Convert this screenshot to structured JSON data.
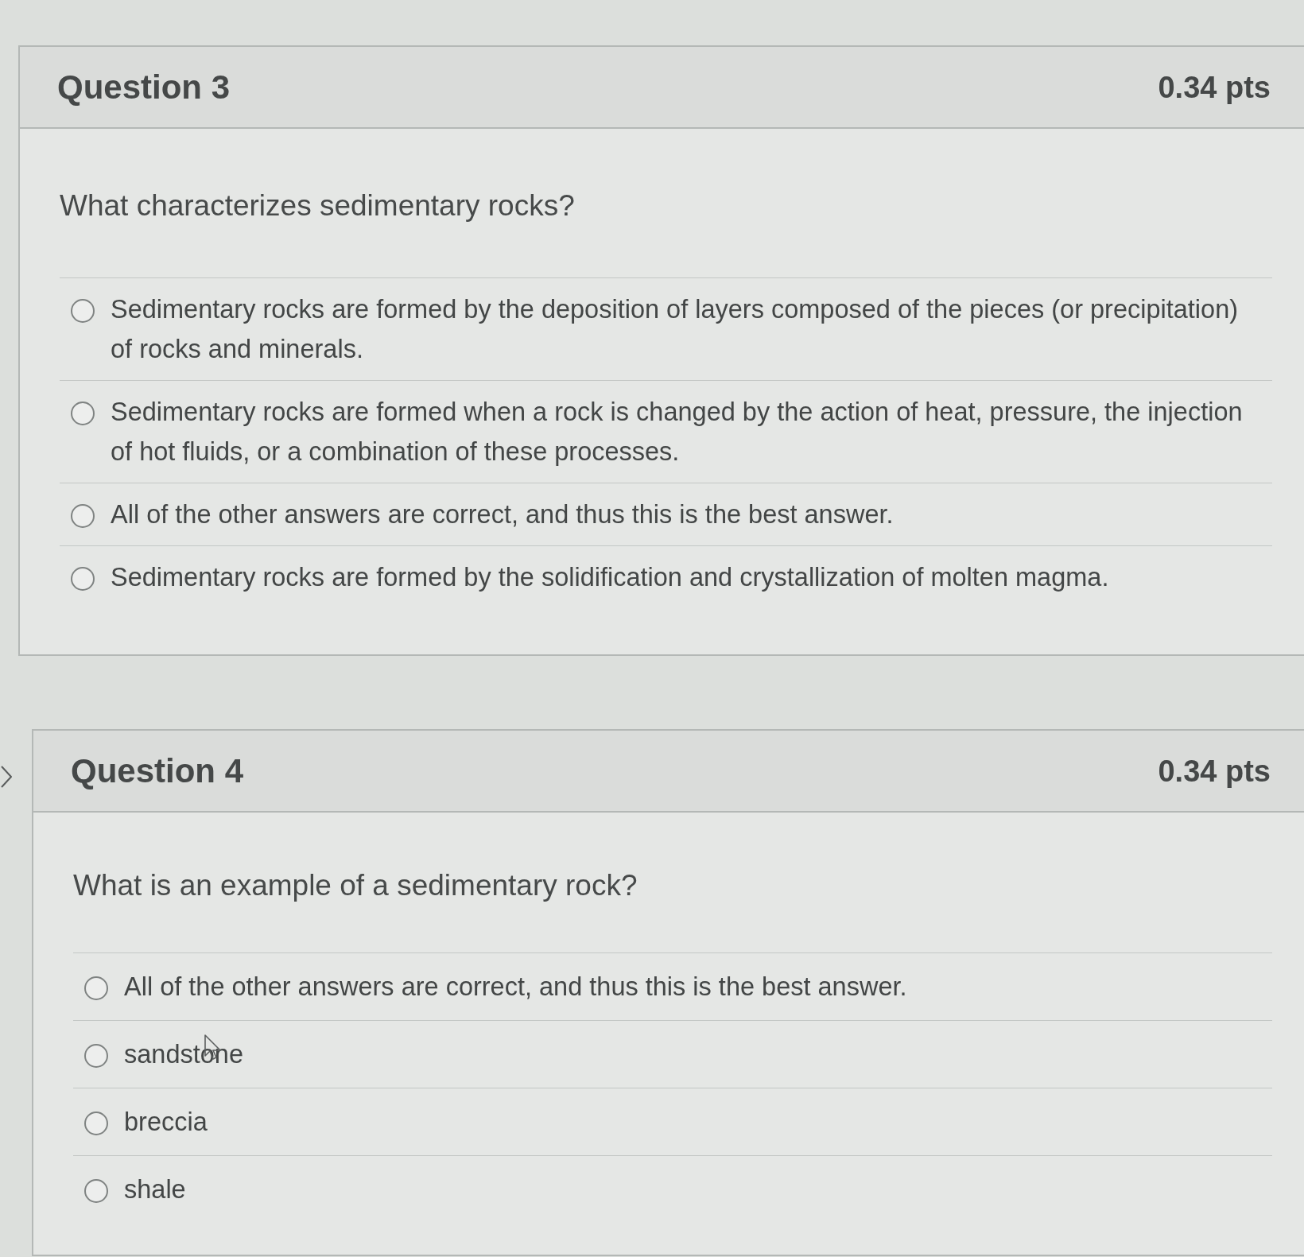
{
  "questions": [
    {
      "title": "Question 3",
      "points": "0.34 pts",
      "prompt": "What characterizes sedimentary rocks?",
      "answers": [
        {
          "text": "Sedimentary rocks are formed by the deposition of layers composed of the pieces (or precipitation) of rocks and minerals.",
          "selected": false,
          "hovered": false
        },
        {
          "text": "Sedimentary rocks are formed when a rock is changed by the action of heat, pressure, the injection of hot fluids, or a combination of these processes.",
          "selected": false,
          "hovered": false
        },
        {
          "text": "All of the other answers are correct, and thus this is the best answer.",
          "selected": false,
          "hovered": false
        },
        {
          "text": "Sedimentary rocks are formed by the solidification and crystallization of molten magma.",
          "selected": false,
          "hovered": false
        }
      ]
    },
    {
      "title": "Question 4",
      "points": "0.34 pts",
      "prompt": "What is an example of a sedimentary rock?",
      "answers": [
        {
          "text": "All of the other answers are correct, and thus this is the best answer.",
          "selected": false,
          "hovered": false
        },
        {
          "text": "sandstone",
          "selected": false,
          "hovered": true
        },
        {
          "text": "breccia",
          "selected": false,
          "hovered": false
        },
        {
          "text": "shale",
          "selected": false,
          "hovered": false
        }
      ]
    }
  ]
}
